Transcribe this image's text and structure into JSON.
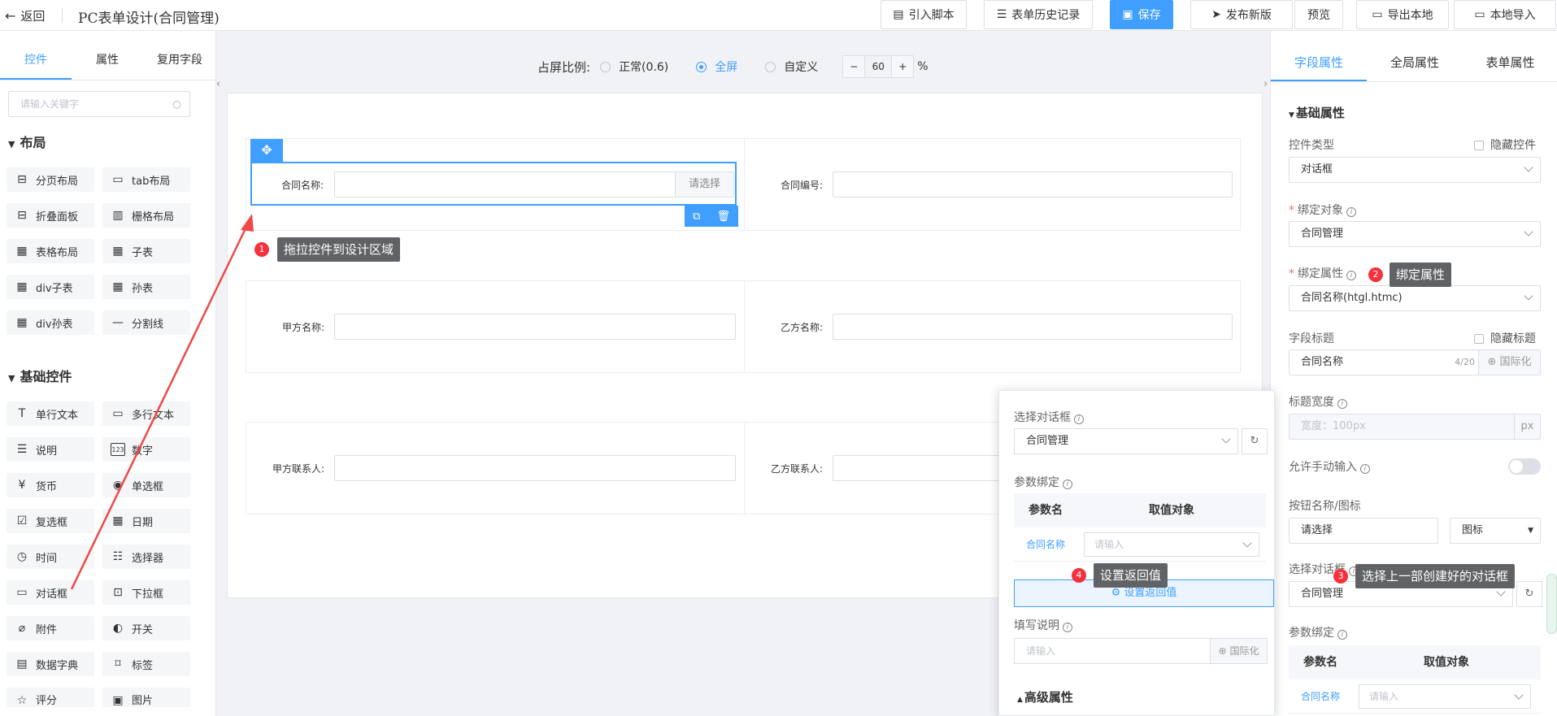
{
  "header": {
    "back": "返回",
    "title": "PC表单设计(合同管理)",
    "buttons": [
      "引入脚本",
      "表单历史记录",
      "保存",
      "发布新版",
      "预览",
      "导出本地",
      "本地导入"
    ]
  },
  "left": {
    "tabs": [
      "控件",
      "属性",
      "复用字段"
    ],
    "search_placeholder": "请输入关键字",
    "sections": [
      {
        "title": "布局",
        "items": [
          "分页布局",
          "tab布局",
          "折叠面板",
          "栅格布局",
          "表格布局",
          "子表",
          "div子表",
          "孙表",
          "div孙表",
          "分割线"
        ]
      },
      {
        "title": "基础控件",
        "items": [
          "单行文本",
          "多行文本",
          "说明",
          "数字",
          "货币",
          "单选框",
          "复选框",
          "日期",
          "时间",
          "选择器",
          "对话框",
          "下拉框",
          "附件",
          "开关",
          "数据字典",
          "标签",
          "评分",
          "图片"
        ]
      }
    ]
  },
  "center": {
    "ratio_label": "占屏比例:",
    "options": [
      "正常(0.6)",
      "全屏",
      "自定义"
    ],
    "selected": "全屏",
    "zoom": "60",
    "zoom_minus": "−",
    "zoom_plus": "+",
    "unit": "%",
    "fields": [
      {
        "label": "合同名称:",
        "button": "请选择"
      },
      {
        "label": "合同编号:"
      },
      {
        "label": "甲方名称:"
      },
      {
        "label": "乙方名称:"
      },
      {
        "label": "甲方联系人:"
      },
      {
        "label": "乙方联系人:"
      }
    ]
  },
  "tips": [
    {
      "n": "1",
      "text": "拖拉控件到设计区域"
    },
    {
      "n": "2",
      "text": "绑定属性"
    },
    {
      "n": "3",
      "text": "选择上一部创建好的对话框"
    },
    {
      "n": "4",
      "text": "设置返回值"
    }
  ],
  "popup": {
    "select_label": "选择对话框",
    "select_value": "合同管理",
    "param_label": "参数绑定",
    "col1": "参数名",
    "col2": "取值对象",
    "param_name": "合同名称",
    "param_ph": "请输入",
    "return_btn": "设置返回值",
    "desc_label": "填写说明",
    "desc_ph": "请输入",
    "i18n": "国际化",
    "adv": "高级属性"
  },
  "right": {
    "tabs": [
      "字段属性",
      "全局属性",
      "表单属性"
    ],
    "basic": "基础属性",
    "type_label": "控件类型",
    "hide_ctrl": "隐藏控件",
    "type_value": "对话框",
    "bind_obj_label": "绑定对象",
    "bind_obj": "合同管理",
    "bind_attr_label": "绑定属性",
    "bind_attr": "合同名称(htgl.htmc)",
    "title_label": "字段标题",
    "hide_title": "隐藏标题",
    "title_value": "合同名称",
    "title_count": "4/20",
    "i18n": "国际化",
    "width_label": "标题宽度",
    "width_ph": "宽度：100px",
    "px": "px",
    "manual_label": "允许手动输入",
    "btn_label": "按钮名称/图标",
    "btn_value": "请选择",
    "icon_label": "图标",
    "dlg_label": "选择对话框",
    "dlg_value": "合同管理",
    "param_label": "参数绑定",
    "col1": "参数名",
    "col2": "取值对象",
    "param_name": "合同名称",
    "param_ph": "请输入"
  }
}
